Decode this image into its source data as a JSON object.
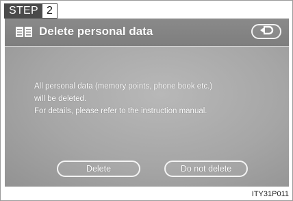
{
  "step": {
    "label": "STEP",
    "number": "2"
  },
  "screen": {
    "title": "Delete personal data",
    "title_icon": "document-list-icon",
    "back_icon": "return-arrow-icon",
    "message_lines": [
      "All personal data (memory points, phone book etc.)",
      "will be deleted.",
      "For details, please refer to the instruction manual."
    ],
    "buttons": {
      "delete": "Delete",
      "do_not_delete": "Do not delete"
    }
  },
  "figure_code": "ITY31P011"
}
